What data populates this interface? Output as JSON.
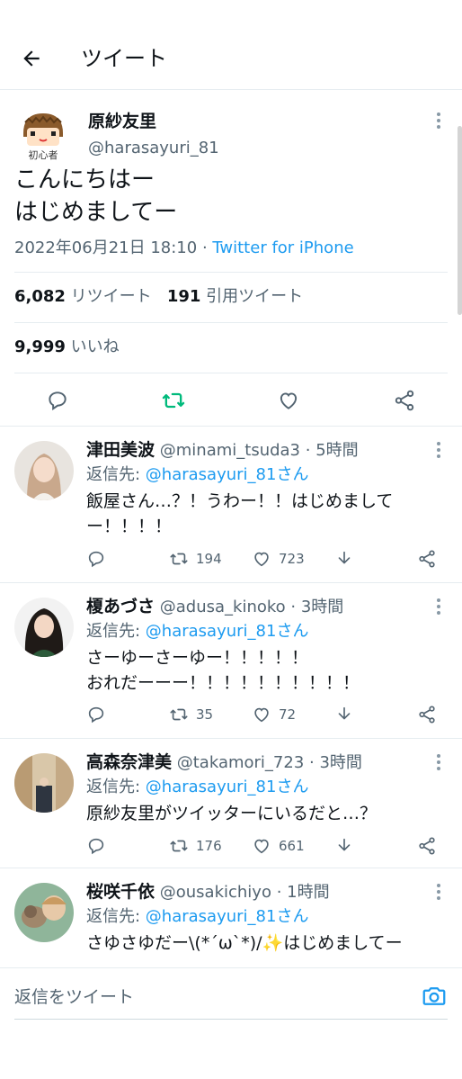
{
  "header": {
    "title": "ツイート",
    "back_icon": "arrow-left-icon"
  },
  "tweet": {
    "author_name": "原紗友里",
    "author_handle": "@harasayuri_81",
    "avatar_caption": "初心者",
    "text": "こんにちはー\nはじめましてー",
    "datetime": "2022年06月21日 18:10",
    "separator": " · ",
    "source": "Twitter for iPhone",
    "retweets": "6,082",
    "retweets_label": "リツイート",
    "quotes": "191",
    "quotes_label": "引用ツイート",
    "likes": "9,999",
    "likes_label": "いいね",
    "retweeted_color": "#00ba7c",
    "actions": [
      "reply-icon",
      "retweet-icon",
      "like-icon",
      "share-icon"
    ]
  },
  "replies": [
    {
      "name": "津田美波",
      "handle": "@minami_tsuda3",
      "time": "5時間",
      "reply_prefix": "返信先: ",
      "reply_to": "@harasayuri_81さん",
      "text": "飯屋さん…？！うわー！！はじめまして\nー！！！！",
      "retweets": "194",
      "likes": "723"
    },
    {
      "name": "榎あづさ",
      "handle": "@adusa_kinoko",
      "time": "3時間",
      "reply_prefix": "返信先: ",
      "reply_to": "@harasayuri_81さん",
      "text": "さーゆーさーゆー！！！！！\nおれだーーー！！！！！！！！！！",
      "retweets": "35",
      "likes": "72"
    },
    {
      "name": "高森奈津美",
      "handle": "@takamori_723",
      "time": "3時間",
      "reply_prefix": "返信先: ",
      "reply_to": "@harasayuri_81さん",
      "text": "原紗友里がツイッターにいるだと…？",
      "retweets": "176",
      "likes": "661"
    },
    {
      "name": "桜咲千依",
      "handle": "@ousakichiyo",
      "time": "1時間",
      "reply_prefix": "返信先: ",
      "reply_to": "@harasayuri_81さん",
      "text": "さゆさゆだー\\(*´ω`*)/✨はじめましてー"
    }
  ],
  "compose": {
    "placeholder": "返信をツイート",
    "camera_icon": "camera-icon"
  },
  "colors": {
    "accent": "#1d9bf0",
    "muted": "#536471",
    "text": "#0f1419",
    "retweet_green": "#00ba7c"
  }
}
